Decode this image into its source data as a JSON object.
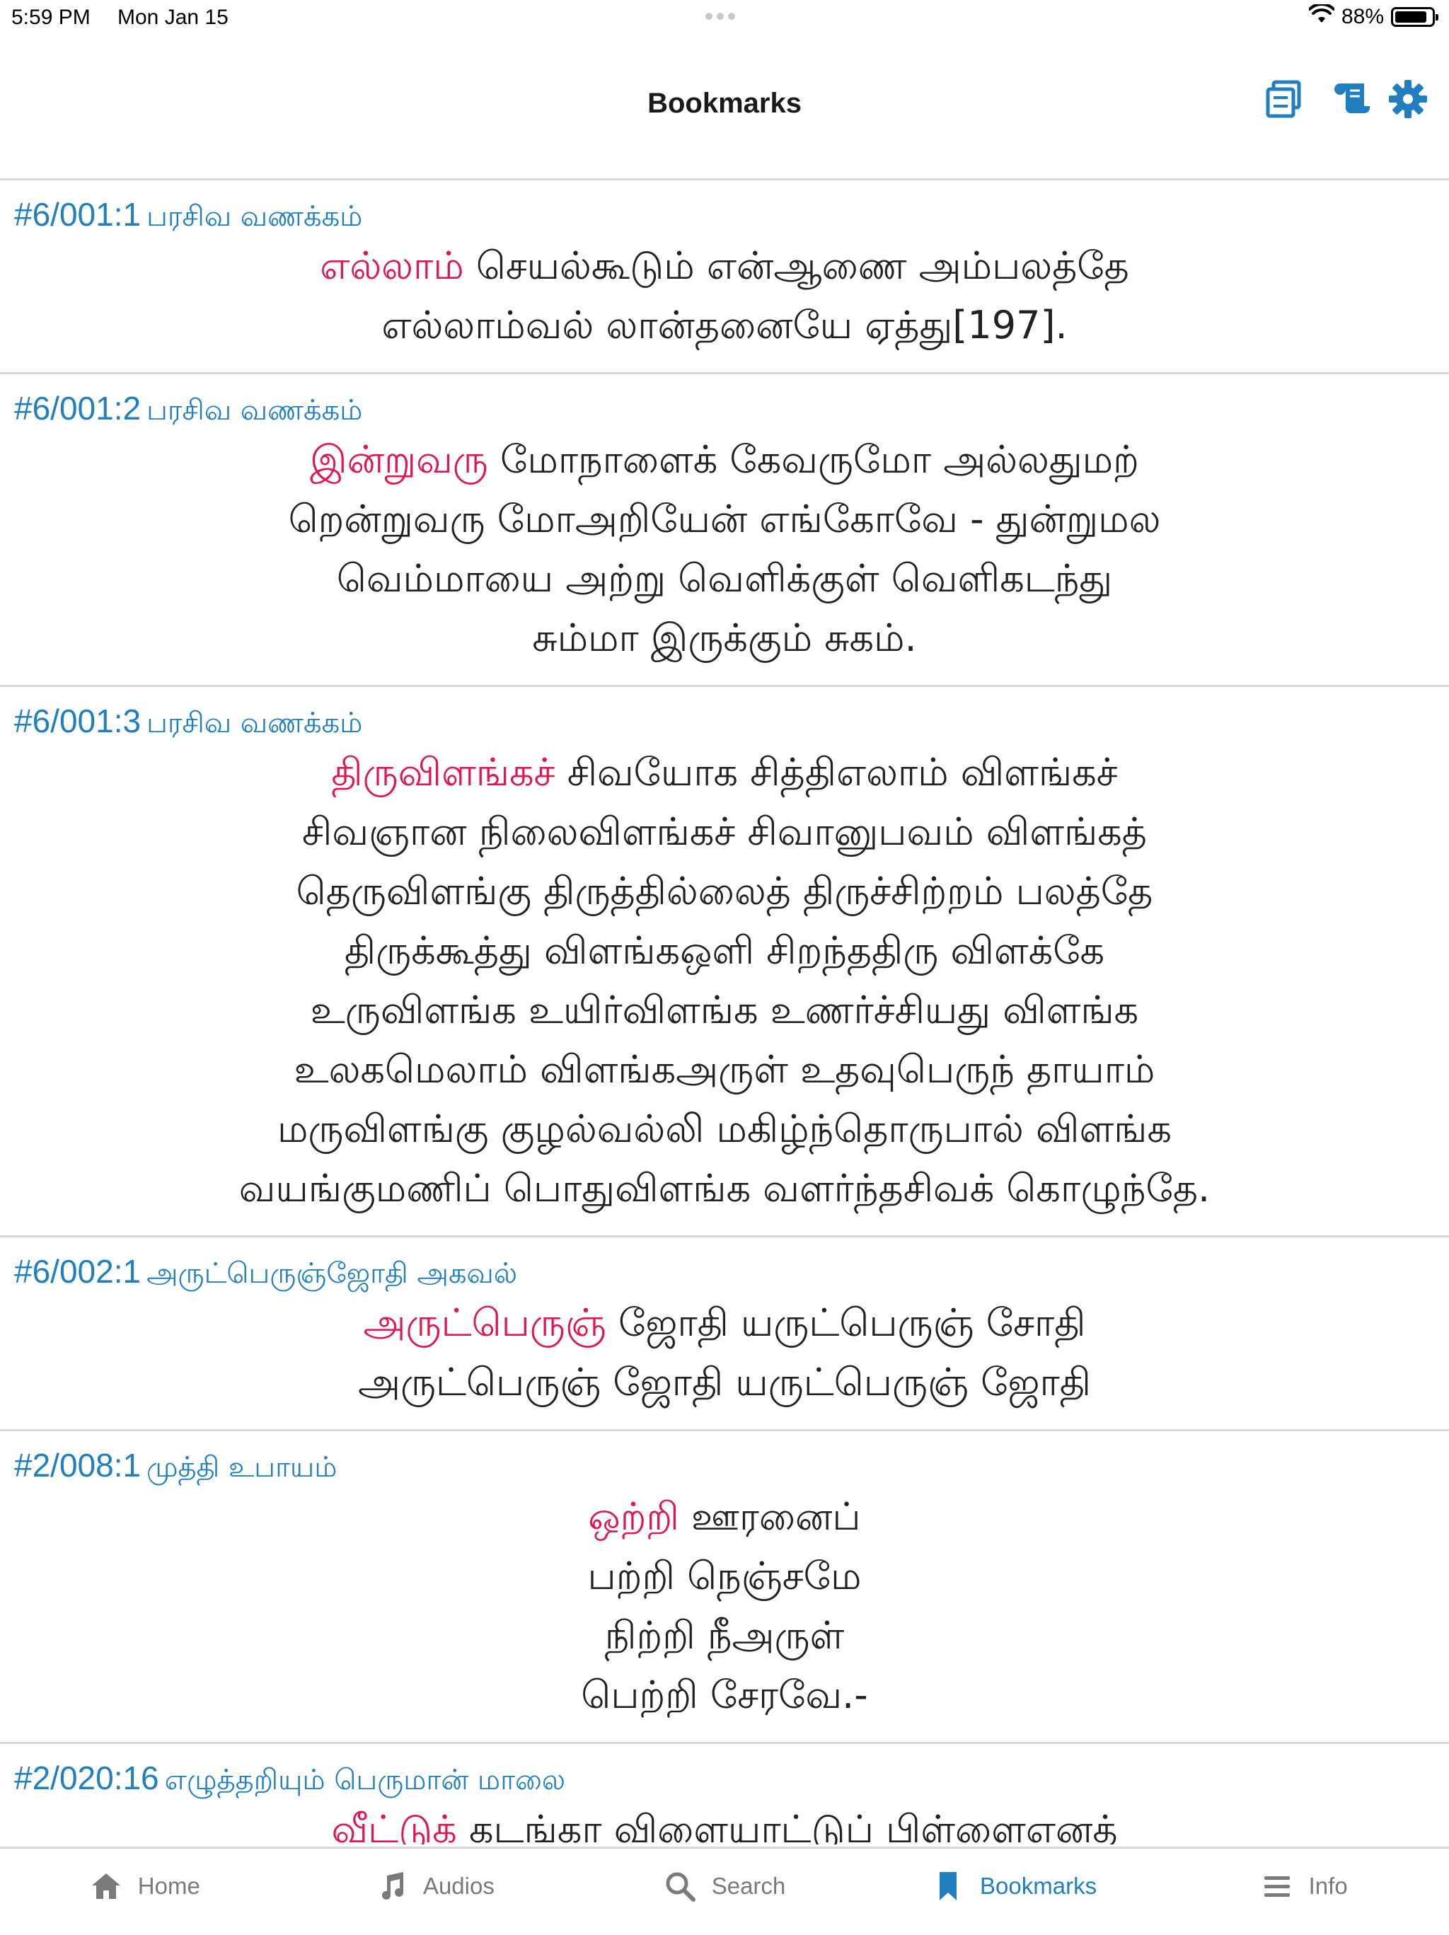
{
  "status_bar": {
    "time": "5:59 PM",
    "date": "Mon Jan 15",
    "battery": "88%",
    "battery_level": 0.88
  },
  "nav": {
    "title": "Bookmarks",
    "icons": [
      "copy-icon",
      "scroll-icon",
      "gear-icon"
    ],
    "accent_color": "#1f7fc0"
  },
  "bookmarks": [
    {
      "ref": "#6/001:1",
      "chapter": "பரசிவ வணக்கம்",
      "lines": [
        {
          "first": "எல்லாம்",
          "rest": " செயல்கூடும் என்ஆணை அம்பலத்தே"
        },
        {
          "first": "",
          "rest": "எல்லாம்வல் லான்தனையே ஏத்து[197]."
        }
      ]
    },
    {
      "ref": "#6/001:2",
      "chapter": "பரசிவ வணக்கம்",
      "lines": [
        {
          "first": "இன்றுவரு",
          "rest": " மோநாளைக் கேவருமோ அல்லதுமற்"
        },
        {
          "first": "",
          "rest": "றென்றுவரு மோஅறியேன் எங்கோவே - துன்றுமல"
        },
        {
          "first": "",
          "rest": "வெம்மாயை அற்று வெளிக்குள் வெளிகடந்து"
        },
        {
          "first": "",
          "rest": "சும்மா இருக்கும் சுகம்."
        }
      ]
    },
    {
      "ref": "#6/001:3",
      "chapter": "பரசிவ வணக்கம்",
      "lines": [
        {
          "first": "திருவிளங்கச்",
          "rest": " சிவயோக சித்திஎலாம் விளங்கச்"
        },
        {
          "first": "",
          "rest": "சிவஞான நிலைவிளங்கச் சிவானுபவம் விளங்கத்"
        },
        {
          "first": "",
          "rest": "தெருவிளங்கு திருத்தில்லைத் திருச்சிற்றம் பலத்தே"
        },
        {
          "first": "",
          "rest": "திருக்கூத்து விளங்கஒளி சிறந்ததிரு விளக்கே"
        },
        {
          "first": "",
          "rest": "உருவிளங்க உயிர்விளங்க உணர்ச்சியது விளங்க"
        },
        {
          "first": "",
          "rest": "உலகமெலாம் விளங்கஅருள் உதவுபெருந் தாயாம்"
        },
        {
          "first": "",
          "rest": "மருவிளங்கு குழல்வல்லி மகிழ்ந்தொருபால் விளங்க"
        },
        {
          "first": "",
          "rest": "வயங்குமணிப் பொதுவிளங்க வளர்ந்தசிவக் கொழுந்தே."
        }
      ]
    },
    {
      "ref": "#6/002:1",
      "chapter": "அருட்பெருஞ்ஜோதி அகவல்",
      "lines": [
        {
          "first": "அருட்பெருஞ்",
          "rest": " ஜோதி யருட்பெருஞ் சோதி"
        },
        {
          "first": "",
          "rest": "அருட்பெருஞ் ஜோதி யருட்பெருஞ் ஜோதி"
        }
      ]
    },
    {
      "ref": "#2/008:1",
      "chapter": "முத்தி உபாயம்",
      "lines": [
        {
          "first": "ஒற்றி",
          "rest": " ஊரனைப்"
        },
        {
          "first": "",
          "rest": "பற்றி நெஞ்சமே"
        },
        {
          "first": "",
          "rest": "நிற்றி நீஅருள்"
        },
        {
          "first": "",
          "rest": "பெற்றி சேரவே.-"
        }
      ]
    },
    {
      "ref": "#2/020:16",
      "chapter": "எழுத்தறியும் பெருமான் மாலை",
      "lines": [
        {
          "first": "வீட்டுக்",
          "rest": " கடங்கா விளையாட்டுப் பிள்ளைஎனத்"
        }
      ]
    }
  ],
  "tabs": [
    {
      "label": "Home",
      "icon": "home-icon",
      "active": false
    },
    {
      "label": "Audios",
      "icon": "music-note-icon",
      "active": false
    },
    {
      "label": "Search",
      "icon": "search-icon",
      "active": false
    },
    {
      "label": "Bookmarks",
      "icon": "bookmark-icon",
      "active": true
    },
    {
      "label": "Info",
      "icon": "menu-icon",
      "active": false
    }
  ]
}
